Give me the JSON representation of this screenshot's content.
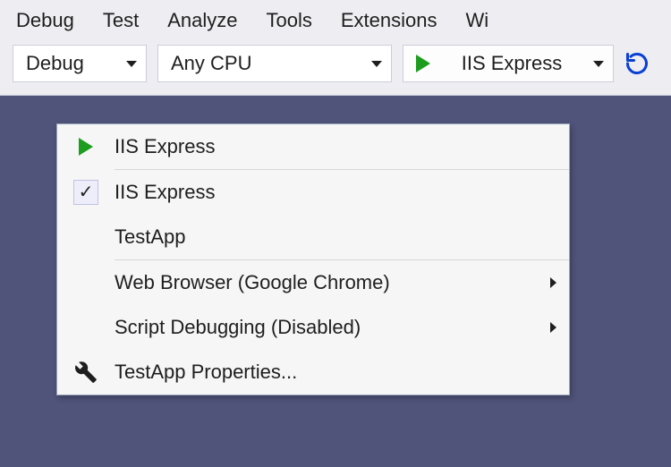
{
  "menubar": {
    "debug": "Debug",
    "test": "Test",
    "analyze": "Analyze",
    "tools": "Tools",
    "extensions": "Extensions",
    "window": "Wi"
  },
  "toolbar": {
    "config": "Debug",
    "platform": "Any CPU",
    "run_label": "IIS Express"
  },
  "dropdown": {
    "primary": "IIS Express",
    "profile_iis": "IIS Express",
    "profile_testapp": "TestApp",
    "browser": "Web Browser (Google Chrome)",
    "script_debug": "Script Debugging (Disabled)",
    "properties": "TestApp Properties..."
  }
}
